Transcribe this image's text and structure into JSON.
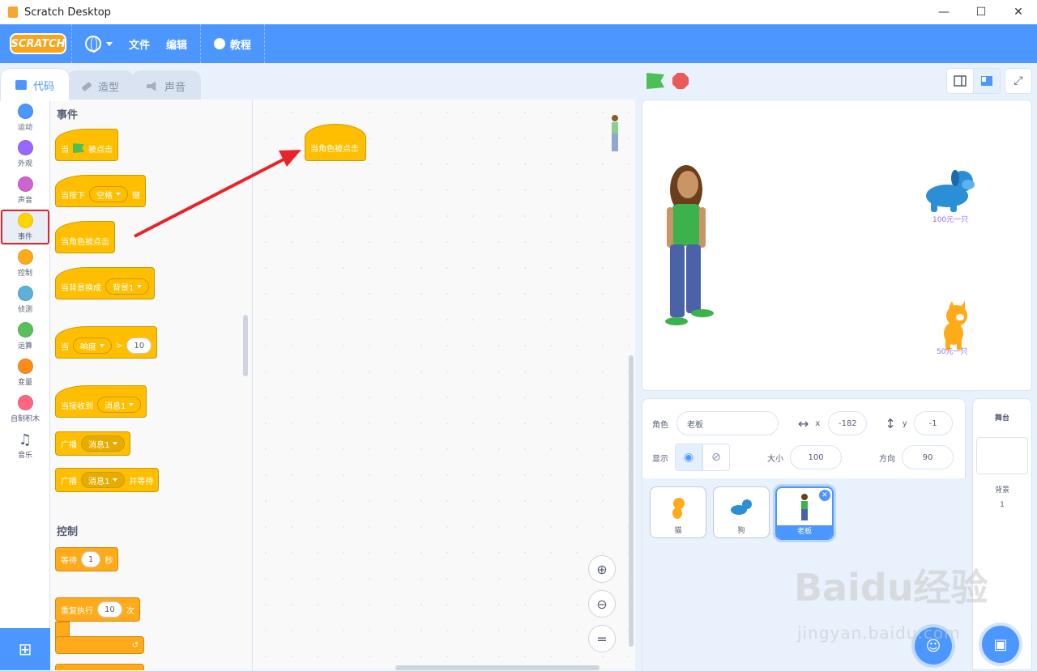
{
  "window": {
    "title": "Scratch Desktop",
    "minimize": "—",
    "maximize": "☐",
    "close": "✕"
  },
  "menubar": {
    "logo": "SCRATCH",
    "file": "文件",
    "edit": "编辑",
    "tutorials": "教程"
  },
  "tabs": [
    {
      "label": "代码"
    },
    {
      "label": "造型"
    },
    {
      "label": "声音"
    }
  ],
  "categories": [
    {
      "label": "运动",
      "color": "#4c97ff"
    },
    {
      "label": "外观",
      "color": "#9966ff"
    },
    {
      "label": "声音",
      "color": "#cf63cf"
    },
    {
      "label": "事件",
      "color": "#ffd500"
    },
    {
      "label": "控制",
      "color": "#ffab19"
    },
    {
      "label": "侦测",
      "color": "#5cb1d6"
    },
    {
      "label": "运算",
      "color": "#59c059"
    },
    {
      "label": "变量",
      "color": "#ff8c1a"
    },
    {
      "label": "自制积木",
      "color": "#ff6680"
    },
    {
      "label": "音乐",
      "icon": "music-note-icon"
    }
  ],
  "palette": {
    "events_heading": "事件",
    "control_heading": "控制",
    "blocks": {
      "flag_clicked_pre": "当",
      "flag_clicked_post": "被点击",
      "key_pressed_pre": "当按下",
      "key_pressed_key": "空格",
      "key_pressed_post": "键",
      "sprite_clicked": "当角色被点击",
      "backdrop_switch": "当背景换成",
      "backdrop_value": "背景1",
      "when_gt_pre": "当",
      "when_gt_value": "响度",
      "when_gt_op": ">",
      "when_gt_num": "10",
      "receive": "当接收到",
      "receive_value": "消息1",
      "broadcast": "广播",
      "broadcast_value": "消息1",
      "broadcast_wait": "广播",
      "broadcast_wait_value": "消息1",
      "broadcast_wait_post": "并等待",
      "wait_pre": "等待",
      "wait_num": "1",
      "wait_post": "秒",
      "repeat_pre": "重复执行",
      "repeat_num": "10",
      "repeat_post": "次"
    }
  },
  "workspace": {
    "block": "当角色被点击",
    "zoom_reset": "="
  },
  "stage": {
    "dog_caption": "100元一只",
    "cat_caption": "50元一只"
  },
  "sprite_info": {
    "sprite_label": "角色",
    "sprite_name": "老板",
    "x_label": "x",
    "x_value": "-182",
    "y_label": "y",
    "y_value": "-1",
    "show_label": "显示",
    "size_label": "大小",
    "size_value": "100",
    "direction_label": "方向",
    "direction_value": "90"
  },
  "sprites": [
    {
      "name": "猫"
    },
    {
      "name": "狗"
    },
    {
      "name": "老板"
    }
  ],
  "stage_pane": {
    "title": "舞台",
    "backdrops_label": "背景",
    "backdrops_count": "1"
  },
  "watermark": {
    "main": "Baidu经验",
    "sub": "jingyan.baidu.com"
  }
}
